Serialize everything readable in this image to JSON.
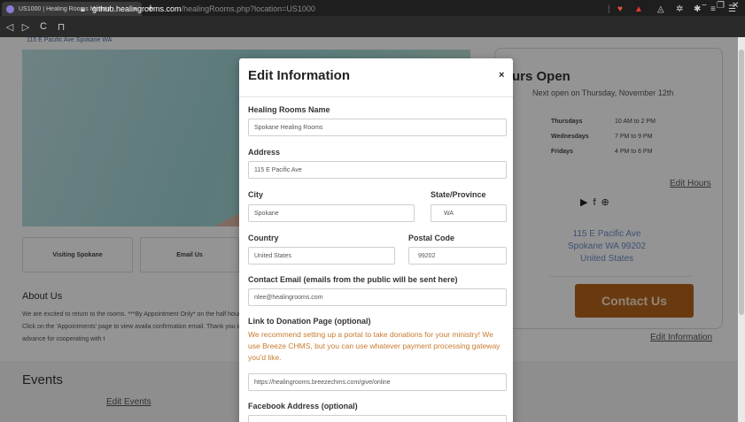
{
  "browser": {
    "tab_title": "US1000 | Healing Rooms Ministri",
    "tab_close": "×",
    "new_tab": "+",
    "url_host": "github.healingrooms.com",
    "url_path": "/healingRooms.php?location=US1000",
    "nav": {
      "back": "◁",
      "forward": "▷",
      "reload": "C",
      "bookmark": "⊓"
    },
    "lock_icon": "🔒",
    "window": {
      "minimize": "−",
      "maximize": "❐",
      "close": "✕"
    }
  },
  "page": {
    "sub_address": "115 E Pacific Ave Spokane WA",
    "cards": [
      "Visiting Spokane",
      "Email Us"
    ],
    "about_title": "About Us",
    "about_text": "We are excited to return to the rooms. ***By Appointment Only* on the half hour. Click on the 'Appointments' page to view availa confirmation email. Thank you in advance for cooperating with t",
    "events_title": "Events",
    "edit_events": "Edit Events",
    "hours_title": "urs Open",
    "hours_sub": "Next open on Thursday, November 12th",
    "schedule": [
      {
        "day": "Thursdays",
        "time": "10 AM to 2 PM"
      },
      {
        "day": "Wednesdays",
        "time": "7 PM to 9 PM"
      },
      {
        "day": "Fridays",
        "time": "4 PM to 6 PM"
      }
    ],
    "edit_hours": "Edit Hours",
    "social_icons": [
      "youtube-icon",
      "facebook-icon",
      "globe-icon"
    ],
    "address_line1": "115 E Pacific Ave",
    "address_line2": "Spokane WA 99202",
    "address_line3": "United States",
    "contact_button": "Contact Us",
    "edit_information": "Edit Information"
  },
  "modal": {
    "title": "Edit Information",
    "close": "×",
    "name_label": "Healing Rooms Name",
    "name_value": "Spokane Healing Rooms",
    "address_label": "Address",
    "address_value": "115 E Pacific Ave",
    "city_label": "City",
    "city_value": "Spokane",
    "state_label": "State/Province",
    "state_value": "WA",
    "country_label": "Country",
    "country_value": "United States",
    "postal_label": "Postal Code",
    "postal_value": "99202",
    "email_label": "Contact Email (emails from the public will be sent here)",
    "email_value": "nlee@healingrooms.com",
    "donation_label": "Link to Donation Page (optional)",
    "donation_note": "We recommend setting up a portal to take donations for your ministry! We use Breeze CHMS, but you can use whatever payment processing gateway you'd like.",
    "donation_value": "https://healingrooms.breezechms.com/give/online",
    "facebook_label": "Facebook Address (optional)",
    "facebook_value": ""
  }
}
